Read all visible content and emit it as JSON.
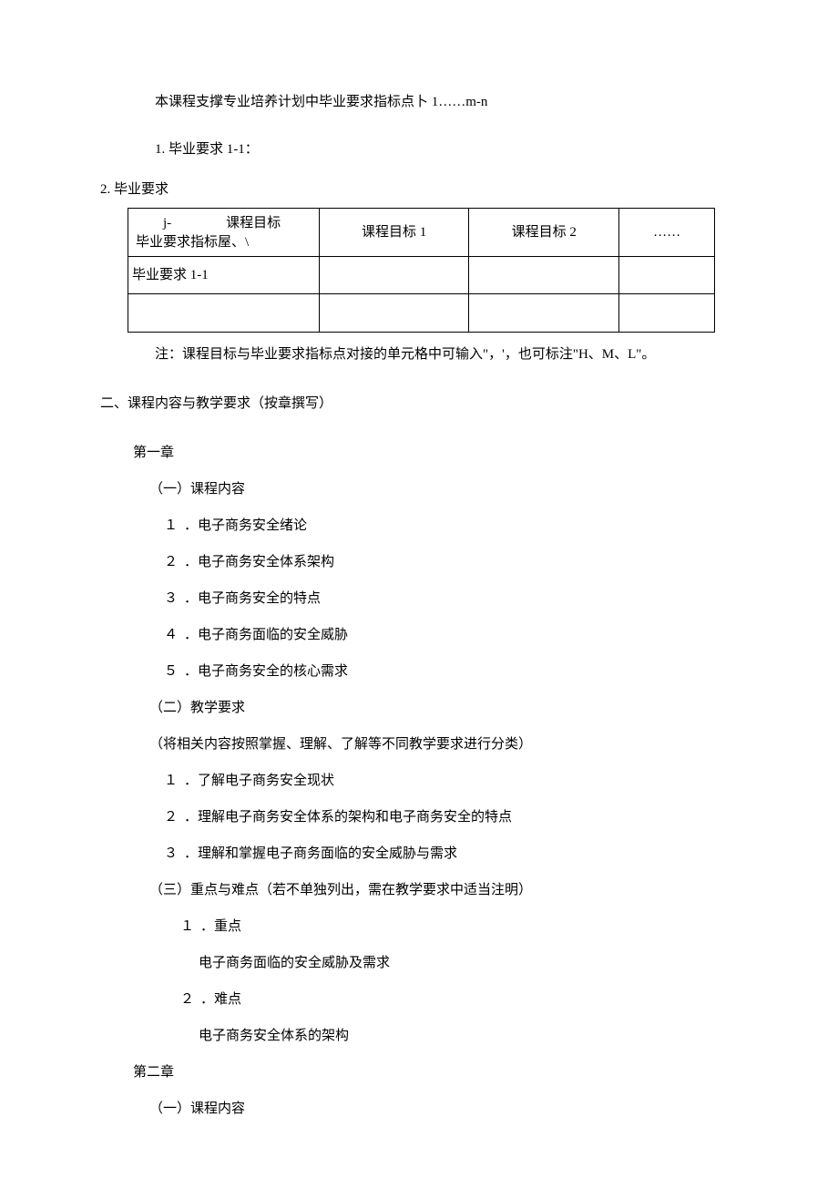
{
  "intro": "本课程支撑专业培养计划中毕业要求指标点卜 1……m-n",
  "req1": "1. 毕业要求 1-1：",
  "req2": "2. 毕业要求",
  "table": {
    "header_top": "j-　　　　课程目标",
    "header_bottom": "毕业要求指标屋、\\",
    "col2": "课程目标 1",
    "col3": "课程目标 2",
    "col4": "……",
    "row1_col1": "毕业要求 1-1",
    "row1_col2": "",
    "row1_col3": "",
    "row1_col4": "",
    "row2_col1": "",
    "row2_col2": "",
    "row2_col3": "",
    "row2_col4": ""
  },
  "note": "注：课程目标与毕业要求指标点对接的单元格中可输入\"，'，也可标注\"H、M、L\"。",
  "section2_title": "二、课程内容与教学要求（按章撰写）",
  "ch1": {
    "title": "第一章",
    "h1": "（一）课程内容",
    "i1": {
      "n": "１",
      "t": "．电子商务安全绪论"
    },
    "i2": {
      "n": "２",
      "t": "．电子商务安全体系架构"
    },
    "i3": {
      "n": "３",
      "t": "．电子商务安全的特点"
    },
    "i4": {
      "n": "４",
      "t": "．电子商务面临的安全威胁"
    },
    "i5": {
      "n": "５",
      "t": "．电子商务安全的核心需求"
    },
    "h2": "（二）教学要求",
    "h2_note": "（将相关内容按照掌握、理解、了解等不同教学要求进行分类）",
    "r1": {
      "n": "１",
      "t": "．了解电子商务安全现状"
    },
    "r2": {
      "n": "２",
      "t": "．理解电子商务安全体系的架构和电子商务安全的特点"
    },
    "r3": {
      "n": "３",
      "t": "．理解和掌握电子商务面临的安全威胁与需求"
    },
    "h3": "（三）重点与难点（若不单独列出，需在教学要求中适当注明）",
    "p1": {
      "n": "１",
      "t": "．重点"
    },
    "p1_text": "电子商务面临的安全威胁及需求",
    "p2": {
      "n": "２",
      "t": "．难点"
    },
    "p2_text": "电子商务安全体系的架构"
  },
  "ch2": {
    "title": "第二章",
    "h1": "（一）课程内容"
  }
}
